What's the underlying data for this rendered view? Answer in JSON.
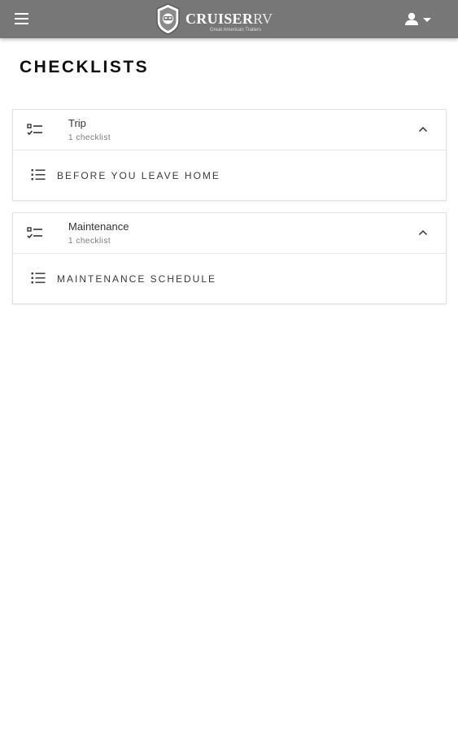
{
  "header": {
    "brand_name": "CRUISER",
    "brand_name_suffix": "RV",
    "brand_tagline": "Great American Trailers",
    "menu_icon": "hamburger-menu-icon",
    "user_icon": "account-icon",
    "user_dropdown_icon": "caret-down-icon",
    "background_color": "#777777"
  },
  "page": {
    "title": "CHECKLISTS"
  },
  "sections": [
    {
      "title": "Trip",
      "count": "1 checklist",
      "icon": "checklist-icon",
      "expanded_icon": "chevron-up-icon",
      "items": [
        {
          "label": "BEFORE YOU LEAVE HOME",
          "icon": "list-icon"
        }
      ]
    },
    {
      "title": "Maintenance",
      "count": "1 checklist",
      "icon": "checklist-icon",
      "expanded_icon": "chevron-up-icon",
      "items": [
        {
          "label": "MAINTENANCE SCHEDULE",
          "icon": "list-icon"
        }
      ]
    }
  ]
}
